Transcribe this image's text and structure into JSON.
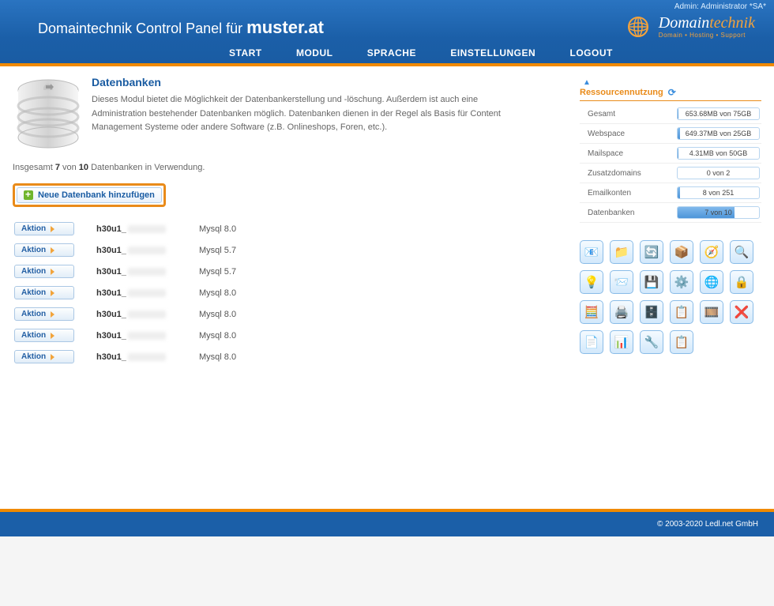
{
  "admin_line": "Admin: Administrator *SA*",
  "panel_title_prefix": "Domaintechnik Control Panel für ",
  "panel_title_domain": "muster.at",
  "logo": {
    "main": "Domain",
    "suffix": "technik",
    "sub": "Domain • Hosting • Support"
  },
  "nav": {
    "start": "START",
    "modul": "MODUL",
    "sprache": "SPRACHE",
    "einstellungen": "EINSTELLUNGEN",
    "logout": "LOGOUT"
  },
  "page": {
    "heading": "Datenbanken",
    "description": "Dieses Modul bietet die Möglichkeit der Datenbankerstellung und -löschung. Außerdem ist auch eine Administration bestehender Datenbanken möglich. Datenbanken dienen in der Regel als Basis für Content Management Systeme oder andere Software (z.B. Onlineshops, Foren, etc.).",
    "summary_prefix": "Insgesamt ",
    "summary_used": "7",
    "summary_mid": " von ",
    "summary_total": "10",
    "summary_suffix": " Datenbanken in Verwendung.",
    "add_button": "Neue Datenbank hinzufügen"
  },
  "databases": [
    {
      "action": "Aktion",
      "name_prefix": "h30u1_",
      "version": "Mysql  8.0"
    },
    {
      "action": "Aktion",
      "name_prefix": "h30u1_",
      "version": "Mysql  5.7"
    },
    {
      "action": "Aktion",
      "name_prefix": "h30u1_",
      "version": "Mysql  5.7"
    },
    {
      "action": "Aktion",
      "name_prefix": "h30u1_",
      "version": "Mysql  8.0"
    },
    {
      "action": "Aktion",
      "name_prefix": "h30u1_",
      "version": "Mysql  8.0"
    },
    {
      "action": "Aktion",
      "name_prefix": "h30u1_",
      "version": "Mysql  8.0"
    },
    {
      "action": "Aktion",
      "name_prefix": "h30u1_",
      "version": "Mysql  8.0"
    }
  ],
  "resources": {
    "title": "Ressourcennutzung",
    "rows": [
      {
        "label": "Gesamt",
        "text": "653.68MB von 75GB",
        "pct": 1
      },
      {
        "label": "Webspace",
        "text": "649.37MB von 25GB",
        "pct": 3
      },
      {
        "label": "Mailspace",
        "text": "4.31MB von 50GB",
        "pct": 1
      },
      {
        "label": "Zusatzdomains",
        "text": "0 von 2",
        "pct": 0
      },
      {
        "label": "Emailkonten",
        "text": "8 von 251",
        "pct": 3
      },
      {
        "label": "Datenbanken",
        "text": "7 von 10",
        "pct": 70
      }
    ]
  },
  "module_icons": [
    "📧",
    "📁",
    "🔄",
    "📦",
    "🧭",
    "🔍",
    "💡",
    "📨",
    "💾",
    "⚙️",
    "🌐",
    "🔒",
    "🧮",
    "🖨️",
    "🗄️",
    "📋",
    "🎞️",
    "❌",
    "📄",
    "📊",
    "🔧",
    "📋"
  ],
  "footer": "© 2003-2020 Ledl.net GmbH"
}
